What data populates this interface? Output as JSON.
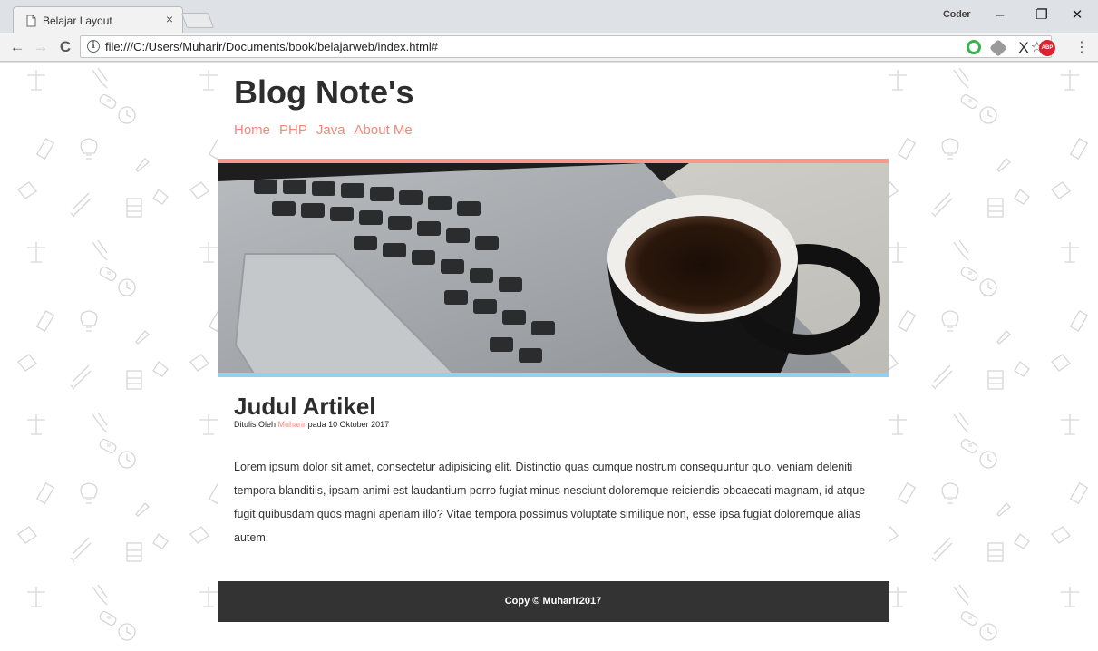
{
  "browser": {
    "tab_title": "Belajar Layout",
    "tab_close": "×",
    "url": "file:///C:/Users/Muharir/Documents/book/belajarweb/index.html#",
    "profile": "Coder",
    "minimize": "–",
    "restore": "❐",
    "close": "✕",
    "back": "←",
    "forward": "→",
    "reload": "C",
    "info": "i",
    "star": "☆",
    "ext_abp": "ABP",
    "ext_x": "X",
    "menu": "⋮"
  },
  "site": {
    "title": "Blog Note's",
    "nav": [
      "Home",
      "PHP",
      "Java",
      "About Me"
    ]
  },
  "article": {
    "title": "Judul Artikel",
    "meta_prefix": "Ditulis Oleh",
    "author": "Muharir",
    "meta_suffix": "pada 10 Oktober 2017",
    "body": "Lorem ipsum dolor sit amet, consectetur adipisicing elit. Distinctio quas cumque nostrum consequuntur quo, veniam deleniti tempora blanditiis, ipsam animi est laudantium porro fugiat minus nesciunt doloremque reiciendis obcaecati magnam, id atque fugit quibusdam quos magni aperiam illo? Vitae tempora possimus voluptate similique non, esse ipsa fugiat doloremque alias autem."
  },
  "footer": {
    "text": "Copy © Muharir2017"
  },
  "colors": {
    "accent": "#f08878",
    "hero_top_bar": "#f59a8b",
    "hero_bottom_bar": "#8fd0f3",
    "footer_bg": "#333333"
  }
}
